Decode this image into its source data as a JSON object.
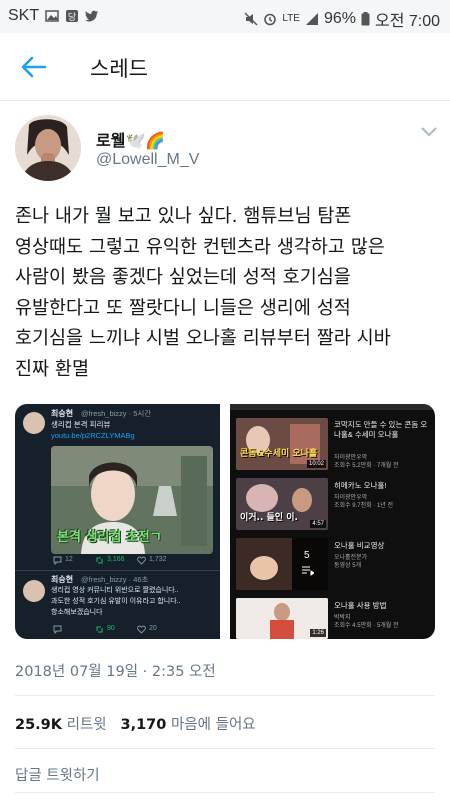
{
  "status_bar": {
    "carrier": "SKT",
    "network": "LTE",
    "battery": "96%",
    "time": "오전 7:00"
  },
  "app_bar": {
    "title": "스레드",
    "back_icon": "back-arrow-icon"
  },
  "author": {
    "name": "로웰🕊️🌈",
    "handle": "@Lowell_M_V"
  },
  "tweet": {
    "lines": [
      "존나 내가 뭘 보고 있나 싶다. 햄튜브님 탐폰",
      "영상때도 그렇고 유익한 컨텐츠라 생각하고 많은",
      "사람이 봤음 좋겠다 싶었는데 성적 호기심을",
      "유발한다고 또 짤랏다니 니들은 생리에 성적",
      "호기심을 느끼냐 시벌 오나홀 리뷰부터 짤라 시바",
      "진짜 환멸"
    ]
  },
  "media_left": {
    "post1_name": "최승현",
    "post1_handle": "@fresh_bizzy · 5시간",
    "post1_text": "생리컵 본격 피리뷰",
    "post1_link": "youtu.be/p2RCZLYMABg",
    "video_caption": "본격 생리컵 초전ㄱ",
    "post1_replies": "12",
    "post1_retweets": "3,166",
    "post1_likes": "1,732",
    "post2_name": "최승현",
    "post2_handle": "@fresh_bizzy · 46초",
    "post2_line1": "생리컵 영상 커뮤니티 위반으로 짤렸습니다..",
    "post2_line2": "과도한 성적 호기심 유발이 이유라고 합니다..",
    "post2_line3": "항소해보겠습니다",
    "post2_retweets": "90",
    "post2_likes": "20"
  },
  "media_right": {
    "items": [
      {
        "title": "코막지도 만들 수 있는 콘돔 오나홀& 수세미 오나홀",
        "channel": "자이광안우막",
        "meta": "조회수 5.2만회 · 7개월 전",
        "thumb_text": "콘돔&수세미 오나홀",
        "duration": "10:02"
      },
      {
        "title": "히메카노 오나홀!",
        "channel": "자이광안우막",
        "meta": "조회수 9.7천회 · 1년 전",
        "thumb_text": "이거.. 들인 이.",
        "duration": "4:57"
      },
      {
        "title": "오나홀 비교영상",
        "channel": "오나홀전문가",
        "meta": "동영상 5개",
        "thumb_text": "5",
        "duration": ""
      },
      {
        "title": "오나홀 사용 방법",
        "channel": "박박지",
        "meta": "조회수 4.5만회 · 5개월 전",
        "thumb_text": "",
        "duration": "1:26"
      }
    ]
  },
  "meta": {
    "timestamp": "2018년 07월 19일 · 2:35 오전",
    "retweet_count": "25.9K",
    "retweet_label": "리트윗",
    "like_count": "3,170",
    "like_label": "마음에 들어요",
    "reply_label": "답글 트윗하기"
  },
  "colors": {
    "accent": "#1da1f2",
    "secondary_text": "#657786",
    "primary_text": "#14171a",
    "divider": "#e6ecf0"
  }
}
